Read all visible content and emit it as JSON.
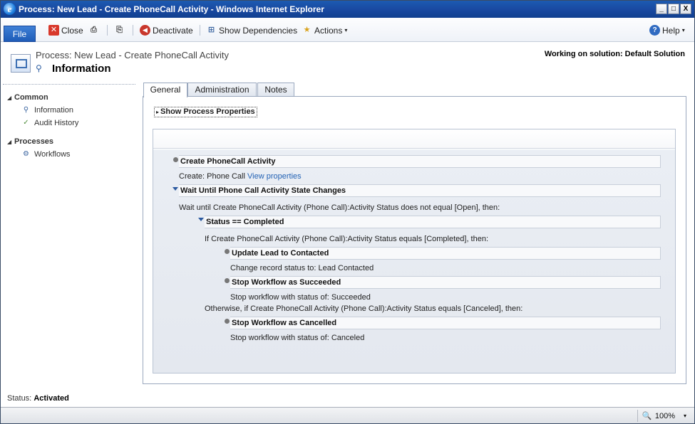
{
  "window": {
    "title": "Process: New Lead - Create PhoneCall Activity - Windows Internet Explorer",
    "minimize": "_",
    "maximize": "□",
    "close": "X"
  },
  "ribbon": {
    "file_label": "File",
    "close_label": "Close",
    "deactivate_label": "Deactivate",
    "show_dependencies_label": "Show Dependencies",
    "actions_label": "Actions",
    "help_label": "Help"
  },
  "header": {
    "entity_title": "Process: New Lead - Create PhoneCall Activity",
    "form_name": "Information",
    "solution": "Working on solution: Default Solution"
  },
  "nav": {
    "groups": [
      {
        "label": "Common",
        "items": [
          {
            "label": "Information"
          },
          {
            "label": "Audit History"
          }
        ]
      },
      {
        "label": "Processes",
        "items": [
          {
            "label": "Workflows"
          }
        ]
      }
    ]
  },
  "tabs": [
    {
      "label": "General",
      "active": true
    },
    {
      "label": "Administration",
      "active": false
    },
    {
      "label": "Notes",
      "active": false
    }
  ],
  "show_process_properties": "Show Process Properties",
  "steps": {
    "create_activity": {
      "title": "Create PhoneCall Activity",
      "desc_prefix": "Create:  Phone Call",
      "desc_link": "View properties"
    },
    "wait": {
      "title": "Wait Until Phone Call Activity State Changes",
      "desc": "Wait until Create PhoneCall Activity (Phone Call):Activity Status does not equal [Open], then:"
    },
    "status_completed": {
      "title": "Status == Completed",
      "desc": "If Create PhoneCall Activity (Phone Call):Activity Status equals [Completed], then:"
    },
    "update_lead": {
      "title": "Update Lead to Contacted",
      "desc": "Change record status to:  Lead  Contacted"
    },
    "stop_succeeded": {
      "title": "Stop Workflow as Succeeded",
      "desc": "Stop workflow with status of:  Succeeded"
    },
    "otherwise": {
      "desc": "Otherwise, if Create PhoneCall Activity (Phone Call):Activity Status equals [Canceled], then:"
    },
    "stop_cancelled": {
      "title": "Stop Workflow as Cancelled",
      "desc": "Stop workflow with status of:  Canceled"
    }
  },
  "status": {
    "label": "Status:",
    "value": "Activated"
  },
  "ie_status": {
    "zoom": "100%"
  }
}
